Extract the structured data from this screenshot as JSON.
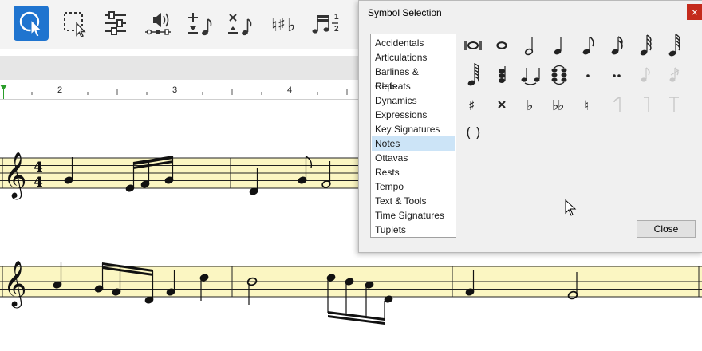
{
  "toolbar": {
    "tools": [
      {
        "icon": "selection-arrow-icon",
        "active": true
      },
      {
        "icon": "marquee-select-icon",
        "active": false
      },
      {
        "icon": "adjust-sliders-icon",
        "active": false
      },
      {
        "icon": "audio-playback-icon",
        "active": false
      },
      {
        "icon": "add-note-icon",
        "active": false
      },
      {
        "icon": "delete-note-icon",
        "active": false
      },
      {
        "icon": "accidentals-icon",
        "active": false
      },
      {
        "icon": "tuplets-icon",
        "active": false
      }
    ],
    "tuplet_numbers": [
      "1",
      "2"
    ]
  },
  "ruler": {
    "labels": [
      "2",
      "3",
      "4"
    ]
  },
  "dialog": {
    "title": "Symbol Selection",
    "close_x": "×",
    "categories": [
      "Accidentals",
      "Articulations",
      "Barlines & Repeats",
      "Clefs",
      "Dynamics",
      "Expressions",
      "Key Signatures",
      "Notes",
      "Ottavas",
      "Rests",
      "Tempo",
      "Text & Tools",
      "Time Signatures",
      "Tuplets"
    ],
    "selected_category": "Notes",
    "symbols": [
      "double-whole-note-icon",
      "whole-note-icon",
      "half-note-icon",
      "quarter-note-icon",
      "eighth-note-icon",
      "sixteenth-note-icon",
      "thirty-second-note-icon",
      "sixty-fourth-note-icon",
      "hundred-twenty-eighth-note-icon",
      "chord-cluster-icon",
      "tie-icon",
      "tied-chord-icon",
      "dot-icon",
      "double-dot-icon",
      "grace-note-icon",
      "grace-note-slash-icon",
      "sharp-icon",
      "double-sharp-icon",
      "flat-icon",
      "double-flat-icon",
      "natural-icon",
      "stem-up-icon",
      "stem-down-icon",
      "stem-both-icon",
      "parentheses-icon"
    ],
    "parentheses_text": "( )",
    "close_button": "Close"
  },
  "score": {
    "time_signature": [
      "4",
      "4"
    ],
    "staff_color": "#fbf6c2"
  }
}
